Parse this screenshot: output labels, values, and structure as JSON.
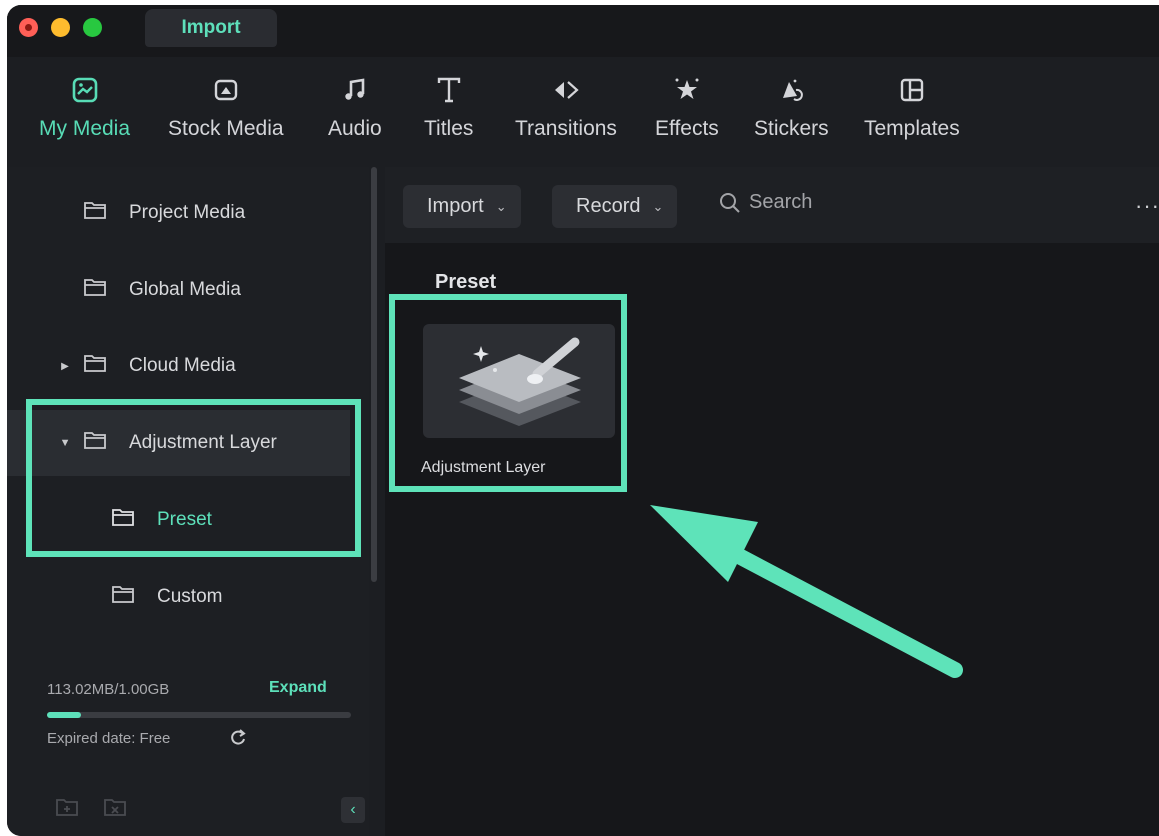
{
  "window": {
    "title_tab": "Import"
  },
  "topnav": {
    "items": [
      {
        "label": "My Media",
        "icon": "my-media-icon",
        "active": true
      },
      {
        "label": "Stock Media",
        "icon": "stock-media-icon"
      },
      {
        "label": "Audio",
        "icon": "music-note-icon"
      },
      {
        "label": "Titles",
        "icon": "text-t-icon"
      },
      {
        "label": "Transitions",
        "icon": "transition-icon"
      },
      {
        "label": "Effects",
        "icon": "star-effect-icon"
      },
      {
        "label": "Stickers",
        "icon": "sticker-icon"
      },
      {
        "label": "Templates",
        "icon": "template-icon"
      }
    ]
  },
  "sidebar": {
    "items": [
      {
        "label": "Project Media"
      },
      {
        "label": "Global Media"
      },
      {
        "label": "Cloud Media"
      },
      {
        "label": "Adjustment Layer"
      },
      {
        "label": "Preset"
      },
      {
        "label": "Custom"
      }
    ],
    "storage": {
      "usage": "113.02MB/1.00GB",
      "expand_label": "Expand",
      "used_fraction": 0.113,
      "expired": "Expired date: Free"
    }
  },
  "toolbar": {
    "import_label": "Import",
    "record_label": "Record",
    "search_placeholder": "Search",
    "more_label": "···"
  },
  "main": {
    "section_title": "Preset",
    "items": [
      {
        "label": "Adjustment Layer"
      }
    ]
  },
  "colors": {
    "accent": "#5de0ba",
    "highlight": "#5ee3b9",
    "window_bg": "#1c1e22",
    "main_bg": "#16171a"
  }
}
